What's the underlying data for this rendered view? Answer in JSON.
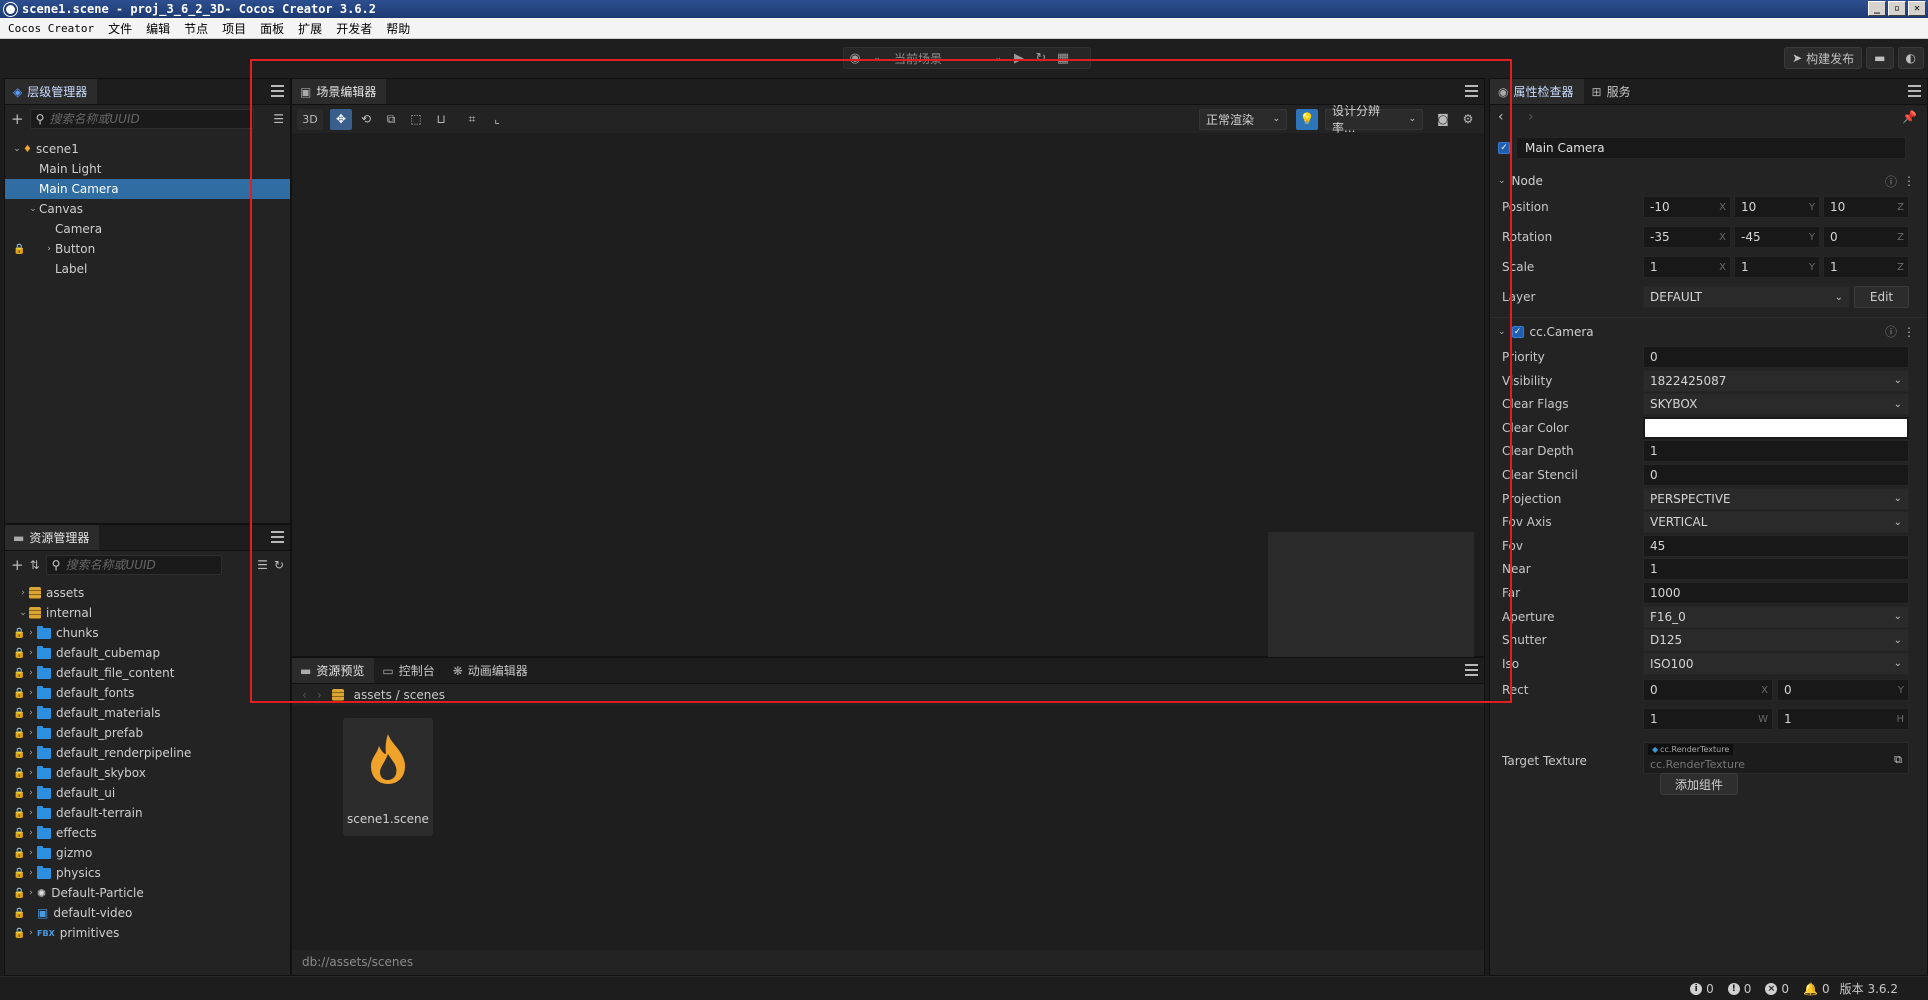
{
  "window": {
    "title": "scene1.scene - proj_3_6_2_3D- Cocos Creator 3.6.2",
    "btn_min": "_",
    "btn_max": "▫",
    "btn_close": "✕"
  },
  "menu": [
    "Cocos Creator",
    "文件",
    "编辑",
    "节点",
    "项目",
    "面板",
    "扩展",
    "开发者",
    "帮助"
  ],
  "toolbar": {
    "scene_select": "当前场景",
    "build_label": "构建发布"
  },
  "hierarchy": {
    "tab": "层级管理器",
    "search_placeholder": "搜索名称或UUID",
    "nodes": [
      {
        "label": "scene1",
        "level": 0,
        "arrow": "⌄",
        "selected": false,
        "lock": false,
        "scene": true
      },
      {
        "label": "Main Light",
        "level": 1,
        "arrow": "",
        "selected": false,
        "lock": false
      },
      {
        "label": "Main Camera",
        "level": 1,
        "arrow": "",
        "selected": true,
        "lock": false
      },
      {
        "label": "Canvas",
        "level": 1,
        "arrow": "⌄",
        "selected": false,
        "lock": false
      },
      {
        "label": "Camera",
        "level": 2,
        "arrow": "",
        "selected": false,
        "lock": false
      },
      {
        "label": "Button",
        "level": 2,
        "arrow": "›",
        "selected": false,
        "lock": true
      },
      {
        "label": "Label",
        "level": 2,
        "arrow": "",
        "selected": false,
        "lock": false
      }
    ]
  },
  "assets": {
    "tab": "资源管理器",
    "search_placeholder": "搜索名称或UUID",
    "items": [
      {
        "label": "assets",
        "level": 0,
        "arrow": "›",
        "icon": "db",
        "lock": false
      },
      {
        "label": "internal",
        "level": 0,
        "arrow": "⌄",
        "icon": "db",
        "lock": false
      },
      {
        "label": "chunks",
        "level": 1,
        "arrow": "›",
        "icon": "folder",
        "lock": true
      },
      {
        "label": "default_cubemap",
        "level": 1,
        "arrow": "›",
        "icon": "folder",
        "lock": true
      },
      {
        "label": "default_file_content",
        "level": 1,
        "arrow": "›",
        "icon": "folder",
        "lock": true
      },
      {
        "label": "default_fonts",
        "level": 1,
        "arrow": "›",
        "icon": "folder",
        "lock": true
      },
      {
        "label": "default_materials",
        "level": 1,
        "arrow": "›",
        "icon": "folder",
        "lock": true
      },
      {
        "label": "default_prefab",
        "level": 1,
        "arrow": "›",
        "icon": "folder",
        "lock": true
      },
      {
        "label": "default_renderpipeline",
        "level": 1,
        "arrow": "›",
        "icon": "folder",
        "lock": true
      },
      {
        "label": "default_skybox",
        "level": 1,
        "arrow": "›",
        "icon": "folder",
        "lock": true
      },
      {
        "label": "default_ui",
        "level": 1,
        "arrow": "›",
        "icon": "folder",
        "lock": true
      },
      {
        "label": "default-terrain",
        "level": 1,
        "arrow": "›",
        "icon": "folder",
        "lock": true
      },
      {
        "label": "effects",
        "level": 1,
        "arrow": "›",
        "icon": "folder",
        "lock": true
      },
      {
        "label": "gizmo",
        "level": 1,
        "arrow": "›",
        "icon": "folder",
        "lock": true
      },
      {
        "label": "physics",
        "level": 1,
        "arrow": "›",
        "icon": "folder",
        "lock": true
      },
      {
        "label": "Default-Particle",
        "level": 1,
        "arrow": "›",
        "icon": "particle",
        "lock": true
      },
      {
        "label": "default-video",
        "level": 1,
        "arrow": "",
        "icon": "video",
        "lock": true
      },
      {
        "label": "primitives",
        "level": 1,
        "arrow": "›",
        "icon": "fbx",
        "lock": true
      }
    ]
  },
  "scene": {
    "tab": "场景编辑器",
    "mode_3d": "3D",
    "render_mode": "正常渲染",
    "resolution": "设计分辨率..."
  },
  "bottom": {
    "tabs": [
      "资源预览",
      "控制台",
      "动画编辑器"
    ],
    "path": "assets / scenes",
    "file_name": "scene1.scene",
    "status_path": "db://assets/scenes"
  },
  "inspector": {
    "tabs": [
      "属性检查器",
      "服务"
    ],
    "node_name": "Main Camera",
    "node_section": "Node",
    "position": {
      "label": "Position",
      "x": "-10",
      "y": "10",
      "z": "10"
    },
    "rotation": {
      "label": "Rotation",
      "x": "-35",
      "y": "-45",
      "z": "0"
    },
    "scale": {
      "label": "Scale",
      "x": "1",
      "y": "1",
      "z": "1"
    },
    "layer": {
      "label": "Layer",
      "value": "DEFAULT",
      "edit": "Edit"
    },
    "camera_section": "cc.Camera",
    "props": [
      {
        "label": "Priority",
        "value": "0",
        "type": "text"
      },
      {
        "label": "Visibility",
        "value": "1822425087",
        "type": "select"
      },
      {
        "label": "Clear Flags",
        "value": "SKYBOX",
        "type": "select"
      },
      {
        "label": "Clear Color",
        "value": "",
        "type": "color"
      },
      {
        "label": "Clear Depth",
        "value": "1",
        "type": "text"
      },
      {
        "label": "Clear Stencil",
        "value": "0",
        "type": "text"
      },
      {
        "label": "Projection",
        "value": "PERSPECTIVE",
        "type": "select"
      },
      {
        "label": "Fov Axis",
        "value": "VERTICAL",
        "type": "select"
      },
      {
        "label": "Fov",
        "value": "45",
        "type": "text"
      },
      {
        "label": "Near",
        "value": "1",
        "type": "text"
      },
      {
        "label": "Far",
        "value": "1000",
        "type": "text"
      },
      {
        "label": "Aperture",
        "value": "F16_0",
        "type": "select"
      },
      {
        "label": "Shutter",
        "value": "D125",
        "type": "select"
      },
      {
        "label": "Iso",
        "value": "ISO100",
        "type": "select"
      }
    ],
    "rect": {
      "label": "Rect",
      "x": "0",
      "y": "0",
      "w": "1",
      "h": "1"
    },
    "target_texture": {
      "label": "Target Texture",
      "tag": "cc.RenderTexture",
      "placeholder": "cc.RenderTexture"
    },
    "add_component": "添加组件"
  },
  "status": {
    "info": "0",
    "warn": "0",
    "error": "0",
    "notify": "0",
    "version": "版本 3.6.2"
  },
  "colors": {
    "selection": "#2f6da3",
    "highlight_frame": "#e02020",
    "scene_icon": "#f0a32a"
  }
}
